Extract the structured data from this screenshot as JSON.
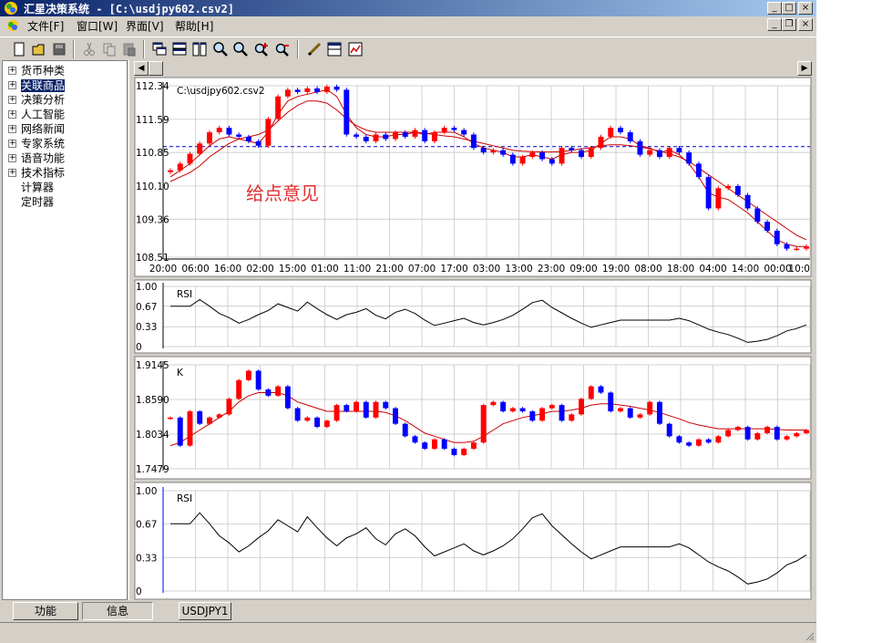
{
  "window": {
    "title": "汇星决策系统 - [C:\\usdjpy602.csv2]"
  },
  "menu": [
    {
      "label": "文件[F]"
    },
    {
      "label": "窗口[W]"
    },
    {
      "label": "界面[V]"
    },
    {
      "label": "帮助[H]"
    }
  ],
  "sidebar": {
    "items": [
      {
        "label": "货币种类",
        "expandable": true,
        "selected": false
      },
      {
        "label": "关联商品",
        "expandable": true,
        "selected": true
      },
      {
        "label": "决策分析",
        "expandable": true,
        "selected": false
      },
      {
        "label": "人工智能",
        "expandable": true,
        "selected": false
      },
      {
        "label": "网络新闻",
        "expandable": true,
        "selected": false
      },
      {
        "label": "专家系统",
        "expandable": true,
        "selected": false
      },
      {
        "label": "语音功能",
        "expandable": true,
        "selected": false
      },
      {
        "label": "技术指标",
        "expandable": true,
        "selected": false
      },
      {
        "label": "计算器",
        "expandable": false,
        "selected": false
      },
      {
        "label": "定时器",
        "expandable": false,
        "selected": false
      }
    ]
  },
  "toolbar": {
    "buttons": [
      {
        "icon": "new-document-icon"
      },
      {
        "icon": "open-folder-icon"
      },
      {
        "icon": "save-icon"
      },
      {
        "icon": "cut-icon"
      },
      {
        "icon": "copy-icon"
      },
      {
        "icon": "paste-icon"
      },
      {
        "icon": "cascade-windows-icon"
      },
      {
        "icon": "tile-horizontal-icon"
      },
      {
        "icon": "tile-vertical-icon"
      },
      {
        "icon": "zoom-in-icon"
      },
      {
        "icon": "zoom-out-icon"
      },
      {
        "icon": "zoom-plus-icon"
      },
      {
        "icon": "zoom-minus-icon"
      },
      {
        "icon": "draw-line-icon"
      },
      {
        "icon": "panel-icon"
      },
      {
        "icon": "chart-icon"
      }
    ]
  },
  "colors": {
    "up_candle": "#ff0000",
    "down_candle": "#0000ff",
    "moving_average": "#cc0000",
    "reference_line": "#0000cc",
    "selection": "#0a246a"
  },
  "main_chart": {
    "file_label": "C:\\usdjpy602.csv2",
    "watermark": "给点意见",
    "y_ticks": [
      "112.34",
      "111.59",
      "110.85",
      "110.10",
      "109.36",
      "108.51"
    ],
    "x_ticks": [
      "20:00",
      "06:00",
      "16:00",
      "02:00",
      "15:00",
      "01:00",
      "11:00",
      "21:00",
      "07:00",
      "17:00",
      "03:00",
      "13:00",
      "23:00",
      "09:00",
      "19:00",
      "08:00",
      "18:00",
      "04:00",
      "14:00",
      "00:00",
      "10:0"
    ]
  },
  "rsi_panel_1": {
    "label": "RSI",
    "y_ticks": [
      "1.00",
      "0.67",
      "0.33",
      "0"
    ]
  },
  "k_panel": {
    "label": "K",
    "y_ticks": [
      "1.9145",
      "1.8590",
      "1.8034",
      "1.7479"
    ]
  },
  "rsi_panel_2": {
    "label": "RSI",
    "y_ticks": [
      "1.00",
      "0.67",
      "0.33",
      "0"
    ]
  },
  "bottom_tabs": [
    {
      "label": "功能",
      "active": true
    },
    {
      "label": "信息",
      "active": false
    }
  ],
  "document_tab": {
    "label": "USDJPY1"
  },
  "chart_data": [
    {
      "type": "candlestick",
      "title": "C:\\usdjpy602.csv2",
      "ylim": [
        108.51,
        112.34
      ],
      "reference_line": 110.98,
      "x_tick_labels": [
        "20:00",
        "06:00",
        "16:00",
        "02:00",
        "15:00",
        "01:00",
        "11:00",
        "21:00",
        "07:00",
        "17:00",
        "03:00",
        "13:00",
        "23:00",
        "09:00",
        "19:00",
        "08:00",
        "18:00",
        "04:00",
        "14:00",
        "00:00",
        "10:0"
      ],
      "close": [
        110.45,
        110.6,
        110.82,
        111.05,
        111.3,
        111.4,
        111.25,
        111.2,
        111.1,
        111.0,
        111.6,
        112.1,
        112.25,
        112.2,
        112.28,
        112.2,
        112.32,
        112.25,
        111.25,
        111.2,
        111.1,
        111.25,
        111.15,
        111.3,
        111.2,
        111.35,
        111.1,
        111.3,
        111.4,
        111.35,
        111.25,
        110.95,
        110.85,
        110.9,
        110.8,
        110.6,
        110.75,
        110.85,
        110.7,
        110.6,
        110.95,
        110.9,
        110.75,
        110.95,
        111.2,
        111.4,
        111.3,
        111.1,
        110.8,
        110.9,
        110.75,
        110.95,
        110.85,
        110.6,
        110.3,
        109.6,
        110.05,
        110.1,
        109.9,
        109.6,
        109.3,
        109.1,
        108.8,
        108.7,
        108.7,
        108.75
      ],
      "moving_average_short": [
        110.3,
        110.45,
        110.6,
        110.8,
        111.0,
        111.15,
        111.2,
        111.15,
        111.1,
        111.05,
        111.3,
        111.7,
        112.0,
        112.1,
        112.15,
        112.2,
        112.25,
        112.1,
        111.7,
        111.4,
        111.25,
        111.2,
        111.2,
        111.25,
        111.25,
        111.3,
        111.25,
        111.3,
        111.3,
        111.3,
        111.2,
        111.05,
        110.95,
        110.9,
        110.85,
        110.75,
        110.75,
        110.8,
        110.75,
        110.7,
        110.8,
        110.85,
        110.85,
        110.9,
        111.05,
        111.2,
        111.2,
        111.15,
        111.0,
        110.95,
        110.85,
        110.9,
        110.8,
        110.6,
        110.3,
        109.95,
        109.85,
        109.8,
        109.65,
        109.5,
        109.3,
        109.1,
        108.9,
        108.8,
        108.75,
        108.75
      ],
      "moving_average_long": [
        110.2,
        110.3,
        110.4,
        110.55,
        110.75,
        110.9,
        111.05,
        111.15,
        111.2,
        111.25,
        111.35,
        111.55,
        111.75,
        111.9,
        112.0,
        112.0,
        111.95,
        111.8,
        111.6,
        111.45,
        111.35,
        111.3,
        111.3,
        111.3,
        111.3,
        111.3,
        111.28,
        111.25,
        111.22,
        111.2,
        111.15,
        111.1,
        111.05,
        111.0,
        110.95,
        110.9,
        110.88,
        110.87,
        110.86,
        110.86,
        110.87,
        110.9,
        110.93,
        110.96,
        111.0,
        111.02,
        111.02,
        111.0,
        110.97,
        110.93,
        110.88,
        110.82,
        110.75,
        110.65,
        110.5,
        110.35,
        110.2,
        110.05,
        109.9,
        109.75,
        109.6,
        109.45,
        109.3,
        109.15,
        109.0,
        108.9
      ]
    },
    {
      "type": "line",
      "title": "RSI",
      "ylim": [
        0,
        1
      ],
      "y_tick_labels": [
        "1.00",
        "0.67",
        "0.33",
        "0"
      ],
      "values": [
        0.67,
        0.67,
        0.67,
        0.78,
        0.67,
        0.55,
        0.48,
        0.39,
        0.45,
        0.53,
        0.6,
        0.71,
        0.65,
        0.59,
        0.74,
        0.63,
        0.53,
        0.45,
        0.53,
        0.57,
        0.63,
        0.52,
        0.46,
        0.57,
        0.62,
        0.55,
        0.44,
        0.35,
        0.39,
        0.43,
        0.47,
        0.4,
        0.36,
        0.4,
        0.45,
        0.52,
        0.62,
        0.73,
        0.77,
        0.65,
        0.56,
        0.47,
        0.39,
        0.32,
        0.36,
        0.4,
        0.44,
        0.44,
        0.44,
        0.44,
        0.44,
        0.44,
        0.47,
        0.43,
        0.36,
        0.29,
        0.24,
        0.2,
        0.14,
        0.07,
        0.09,
        0.12,
        0.18,
        0.26,
        0.3,
        0.36
      ]
    },
    {
      "type": "candlestick",
      "title": "K",
      "ylim": [
        1.7479,
        1.9145
      ],
      "y_tick_labels": [
        "1.9145",
        "1.8590",
        "1.8034",
        "1.7479"
      ],
      "close": [
        1.83,
        1.785,
        1.84,
        1.82,
        1.83,
        1.835,
        1.86,
        1.89,
        1.905,
        1.875,
        1.865,
        1.88,
        1.845,
        1.825,
        1.83,
        1.815,
        1.825,
        1.85,
        1.84,
        1.855,
        1.83,
        1.855,
        1.845,
        1.82,
        1.8,
        1.79,
        1.78,
        1.795,
        1.78,
        1.77,
        1.78,
        1.79,
        1.85,
        1.855,
        1.84,
        1.845,
        1.84,
        1.825,
        1.845,
        1.85,
        1.825,
        1.835,
        1.86,
        1.88,
        1.87,
        1.84,
        1.845,
        1.83,
        1.835,
        1.855,
        1.82,
        1.8,
        1.79,
        1.785,
        1.795,
        1.79,
        1.8,
        1.81,
        1.815,
        1.795,
        1.805,
        1.815,
        1.795,
        1.8,
        1.805,
        1.81
      ],
      "moving_average": [
        1.785,
        1.79,
        1.8,
        1.81,
        1.82,
        1.83,
        1.84,
        1.855,
        1.865,
        1.87,
        1.87,
        1.87,
        1.865,
        1.855,
        1.85,
        1.845,
        1.84,
        1.84,
        1.84,
        1.84,
        1.84,
        1.84,
        1.838,
        1.833,
        1.825,
        1.815,
        1.805,
        1.8,
        1.795,
        1.79,
        1.79,
        1.792,
        1.8,
        1.81,
        1.82,
        1.825,
        1.83,
        1.833,
        1.836,
        1.84,
        1.84,
        1.842,
        1.845,
        1.85,
        1.852,
        1.852,
        1.85,
        1.848,
        1.845,
        1.842,
        1.838,
        1.833,
        1.828,
        1.822,
        1.818,
        1.815,
        1.812,
        1.812,
        1.812,
        1.812,
        1.812,
        1.812,
        1.811,
        1.81,
        1.81,
        1.81
      ]
    },
    {
      "type": "line",
      "title": "RSI",
      "ylim": [
        0,
        1
      ],
      "y_tick_labels": [
        "1.00",
        "0.67",
        "0.33",
        "0"
      ],
      "values": [
        0.67,
        0.67,
        0.67,
        0.78,
        0.67,
        0.55,
        0.48,
        0.39,
        0.45,
        0.53,
        0.6,
        0.71,
        0.65,
        0.59,
        0.74,
        0.63,
        0.53,
        0.45,
        0.53,
        0.57,
        0.63,
        0.52,
        0.46,
        0.57,
        0.62,
        0.55,
        0.44,
        0.35,
        0.39,
        0.43,
        0.47,
        0.4,
        0.36,
        0.4,
        0.45,
        0.52,
        0.62,
        0.73,
        0.77,
        0.65,
        0.56,
        0.47,
        0.39,
        0.32,
        0.36,
        0.4,
        0.44,
        0.44,
        0.44,
        0.44,
        0.44,
        0.44,
        0.47,
        0.43,
        0.36,
        0.29,
        0.24,
        0.2,
        0.14,
        0.07,
        0.09,
        0.12,
        0.18,
        0.26,
        0.3,
        0.36
      ]
    }
  ]
}
